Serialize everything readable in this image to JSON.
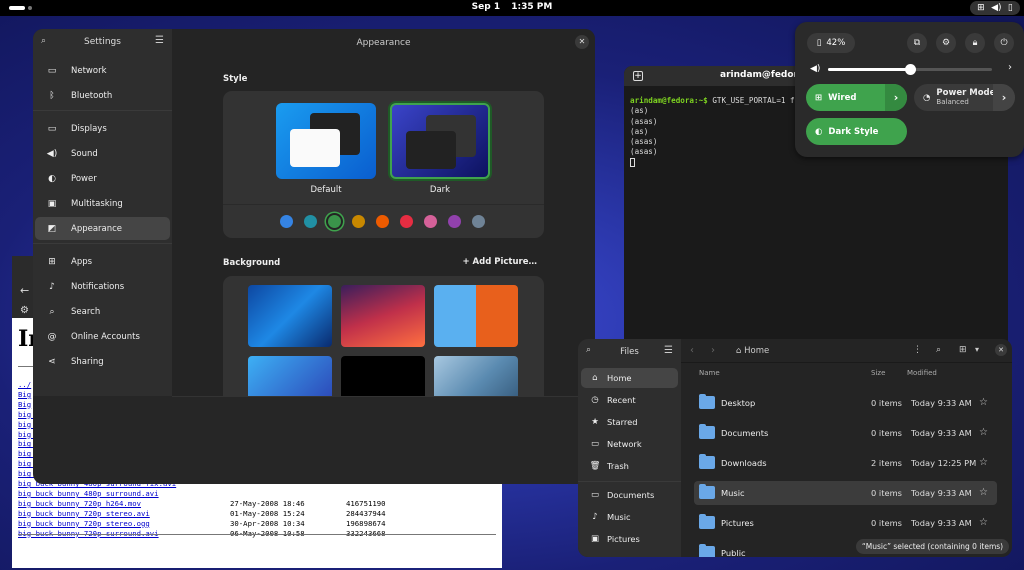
{
  "topbar": {
    "date": "Sep 1",
    "time": "1:35 PM",
    "tray_icons": [
      "network-icon",
      "volume-icon",
      "battery-icon"
    ]
  },
  "browser": {
    "heading": "In",
    "parent_link": "../",
    "partial_links": [
      "Big",
      "Big"
    ],
    "files": [
      {
        "name": "big_buck_bunny_1080p_h264.mov",
        "date": "",
        "size": ""
      },
      {
        "name": "big_buck_bunny_1080p_stereo.avi",
        "date": "",
        "size": ""
      },
      {
        "name": "big_buck_bunny_1080p_stereo.ogg",
        "date": "",
        "size": ""
      },
      {
        "name": "big_buck_bunny_1080p_surround.avi",
        "date": "",
        "size": ""
      },
      {
        "name": "big_buck_bunny_480p_h264.mov",
        "date": "",
        "size": ""
      },
      {
        "name": "big_buck_bunny_480p_stereo.avi",
        "date": "",
        "size": ""
      },
      {
        "name": "big_buck_bunny_480p_stereo.ogg",
        "date": "",
        "size": ""
      },
      {
        "name": "big_buck_bunny_480p_surround-fix.avi",
        "date": "",
        "size": ""
      },
      {
        "name": "big_buck_bunny_480p_surround.avi",
        "date": "",
        "size": ""
      },
      {
        "name": "big_buck_bunny_720p_h264.mov",
        "date": "27-May-2008 18:46",
        "size": "416751190"
      },
      {
        "name": "big_buck_bunny_720p_stereo.avi",
        "date": "01-May-2008 15:24",
        "size": "284437944"
      },
      {
        "name": "big_buck_bunny_720p_stereo.ogg",
        "date": "30-Apr-2008 10:34",
        "size": "196898674"
      },
      {
        "name": "big_buck_bunny_720p_surround.avi",
        "date": "06-May-2008 10:58",
        "size": "332243668"
      }
    ]
  },
  "terminal": {
    "title": "arindam@fedora:~",
    "prompt": "arindam@fedora:~$",
    "command": "GTK_USE_PORTAL=1 f",
    "output": [
      "(as)",
      "(asas)",
      "(as)",
      "(asas)",
      "(asas)"
    ]
  },
  "settings": {
    "sidebar_title": "Settings",
    "page_title": "Appearance",
    "sidebar_items": [
      {
        "label": "Network",
        "icon": "network-icon"
      },
      {
        "label": "Bluetooth",
        "icon": "bluetooth-icon"
      },
      {
        "label": "Displays",
        "icon": "display-icon"
      },
      {
        "label": "Sound",
        "icon": "sound-icon"
      },
      {
        "label": "Power",
        "icon": "power-icon"
      },
      {
        "label": "Multitasking",
        "icon": "multitasking-icon"
      },
      {
        "label": "Appearance",
        "icon": "appearance-icon"
      },
      {
        "label": "Apps",
        "icon": "apps-icon"
      },
      {
        "label": "Notifications",
        "icon": "bell-icon"
      },
      {
        "label": "Search",
        "icon": "search-icon"
      },
      {
        "label": "Online Accounts",
        "icon": "at-icon"
      },
      {
        "label": "Sharing",
        "icon": "share-icon"
      }
    ],
    "style_label": "Style",
    "style_default": "Default",
    "style_dark": "Dark",
    "background_label": "Background",
    "add_picture": "Add Picture…",
    "accent_colors": [
      "#3584e4",
      "#2190a4",
      "#3a944a",
      "#c88800",
      "#ed5b00",
      "#e62d42",
      "#d56199",
      "#9141ac",
      "#6f8396"
    ],
    "selected_accent": 2
  },
  "quick": {
    "battery": "42%",
    "wired": "Wired",
    "power_mode": "Power Mode",
    "power_mode_value": "Balanced",
    "dark_style": "Dark Style",
    "volume_level": 0.5
  },
  "files": {
    "title": "Files",
    "location": "Home",
    "columns": {
      "name": "Name",
      "size": "Size",
      "modified": "Modified"
    },
    "places": [
      {
        "label": "Home",
        "icon": "home-icon"
      },
      {
        "label": "Recent",
        "icon": "recent-icon"
      },
      {
        "label": "Starred",
        "icon": "star-icon"
      },
      {
        "label": "Network",
        "icon": "network-icon"
      },
      {
        "label": "Trash",
        "icon": "trash-icon"
      }
    ],
    "bookmarks": [
      {
        "label": "Documents",
        "icon": "folder-icon"
      },
      {
        "label": "Music",
        "icon": "music-icon"
      },
      {
        "label": "Pictures",
        "icon": "pictures-icon"
      }
    ],
    "rows": [
      {
        "name": "Desktop",
        "size": "0 items",
        "modified": "Today 9:33 AM"
      },
      {
        "name": "Documents",
        "size": "0 items",
        "modified": "Today 9:33 AM"
      },
      {
        "name": "Downloads",
        "size": "2 items",
        "modified": "Today 12:25 PM"
      },
      {
        "name": "Music",
        "size": "0 items",
        "modified": "Today 9:33 AM"
      },
      {
        "name": "Pictures",
        "size": "0 items",
        "modified": "Today 9:33 AM"
      },
      {
        "name": "Public",
        "size": "",
        "modified": ""
      }
    ],
    "selected_row": 3,
    "status": "“Music” selected  (containing 0 items)"
  }
}
